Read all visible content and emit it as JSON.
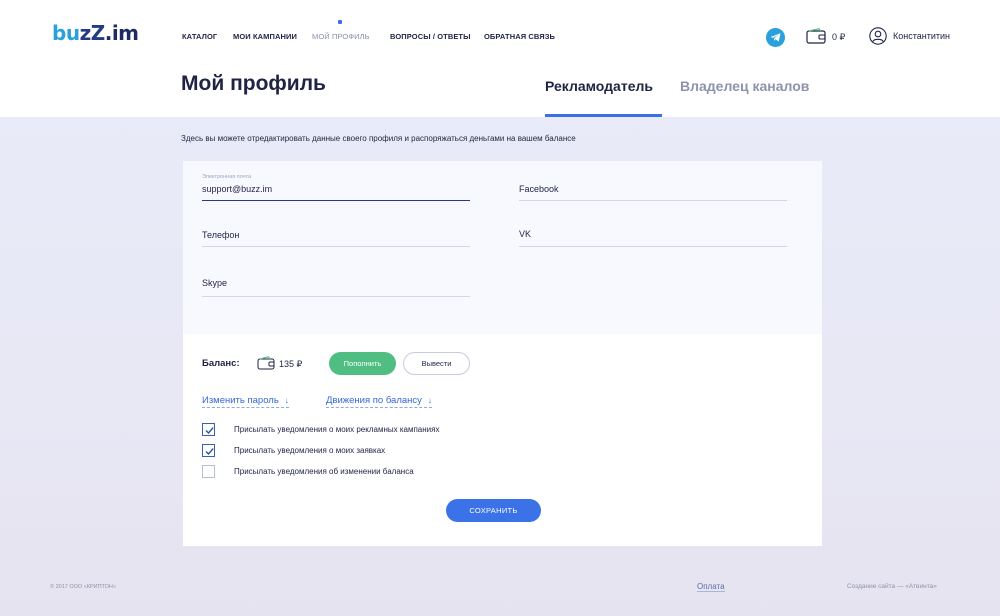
{
  "header": {
    "logo": {
      "part1": "bu",
      "part2": "zZ",
      "part3": ".im"
    },
    "nav": [
      {
        "label": "Каталог"
      },
      {
        "label": "Мои кампании"
      },
      {
        "label": "Мой профиль"
      },
      {
        "label": "Вопросы / ответы"
      },
      {
        "label": "Обратная связь"
      }
    ],
    "active_nav": "Мой профиль",
    "balance": "0 ₽",
    "user_name": "Константитин",
    "icons": [
      "telegram-icon",
      "wallet-icon",
      "user-icon"
    ]
  },
  "page": {
    "title": "Мой профиль",
    "tabs": [
      {
        "label": "Рекламодатель",
        "active": true
      },
      {
        "label": "Владелец каналов",
        "active": false
      }
    ],
    "description": "Здесь вы можете отредактировать данные своего профиля и распоряжаться деньгами на вашем балансе"
  },
  "form": {
    "email": {
      "label": "Электронная почта",
      "value": "support@buzz.im"
    },
    "facebook": {
      "placeholder": "Facebook"
    },
    "phone": {
      "placeholder": "Телефон"
    },
    "vk": {
      "placeholder": "VK"
    },
    "skype": {
      "placeholder": "Skype"
    }
  },
  "balance": {
    "label": "Баланс:",
    "amount": "135 ₽",
    "topup_label": "Пополнить",
    "withdraw_label": "Вывести"
  },
  "links": {
    "change_password": "Изменить пароль",
    "balance_movements": "Движения по балансу",
    "arrow": "↓"
  },
  "notifications": [
    {
      "label": "Присылать уведомления о моих рекламных кампаниях",
      "checked": true
    },
    {
      "label": "Присылать уведомления о моих заявках",
      "checked": true
    },
    {
      "label": "Присылать уведомления об изменении баланса",
      "checked": false
    }
  ],
  "save_label": "Сохранить",
  "footer": {
    "copyright": "© 2017 ООО «КРИПТОН»",
    "payment": "Оплата",
    "credit": "Создание сайта — «Атвинта»"
  },
  "colors": {
    "accent": "#3b6fe8",
    "green": "#50bd83",
    "telegram": "#2aa0dc",
    "dark": "#1f2344"
  }
}
